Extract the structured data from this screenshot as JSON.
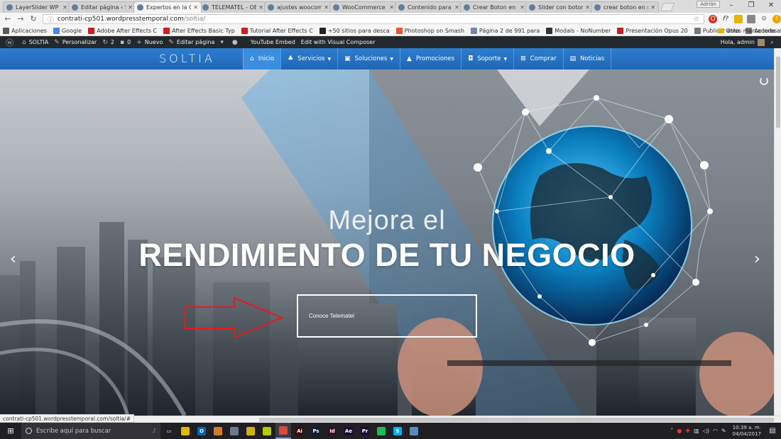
{
  "browser": {
    "tabs": [
      {
        "label": "LayerSlider WP - SOL",
        "active": false
      },
      {
        "label": "Editar página ‹ SOL",
        "active": false
      },
      {
        "label": "Expertos en la Cons",
        "active": true
      },
      {
        "label": "TELEMATEL - OBRA",
        "active": false
      },
      {
        "label": "ajustes woocomme",
        "active": false
      },
      {
        "label": "WooCommerce Me",
        "active": false
      },
      {
        "label": "Contenido para Wo",
        "active": false
      },
      {
        "label": "Crear Boton en slid",
        "active": false
      },
      {
        "label": "Slider con boton co",
        "active": false
      },
      {
        "label": "crear boton en slid",
        "active": false
      }
    ],
    "user_badge": "Adrián",
    "url_host": "contrati-cp501.wordpresstemporal.com",
    "url_path": "/soltia/",
    "bookmarks": [
      {
        "label": "Aplicaciones",
        "color": "#5a5a5a"
      },
      {
        "label": "Google",
        "color": "#4285f4"
      },
      {
        "label": "Adobe After Effects C",
        "color": "#cc1f1f"
      },
      {
        "label": "After Effects Basic Typ",
        "color": "#cc1f1f"
      },
      {
        "label": "Tutorial After Effects C",
        "color": "#cc1f1f"
      },
      {
        "label": "+50 sitios para desca",
        "color": "#222222"
      },
      {
        "label": "Photoshop on Smash",
        "color": "#e55a2b"
      },
      {
        "label": "Página 2 de 991 para",
        "color": "#6a8ab5"
      },
      {
        "label": "Modals - NoNumber",
        "color": "#333333"
      },
      {
        "label": "Presentación Opus 20",
        "color": "#cc1f1f"
      },
      {
        "label": "Publicar esto",
        "color": "#777777"
      },
      {
        "label": "Acceda al Webmail de",
        "color": "#777777"
      }
    ],
    "bookmarks_more": "»",
    "other_bookmarks": "Otros marcadores"
  },
  "wpbar": {
    "site": "SOLTIA",
    "customize": "Personalizar",
    "updates": "2",
    "comments": "0",
    "new": "Nuevo",
    "edit_page": "Editar página",
    "youtube_embed": "YouTube Embed",
    "visual_composer": "Edit with Visual Composer",
    "howdy": "Hola, admin"
  },
  "site": {
    "logo": "SOLTIA",
    "menu": [
      {
        "label": "Inicio",
        "icon": "⌂",
        "active": true,
        "caret": false
      },
      {
        "label": "Servicios",
        "icon": "♣",
        "active": false,
        "caret": true
      },
      {
        "label": "Soluciones",
        "icon": "▣",
        "active": false,
        "caret": true
      },
      {
        "label": "Promociones",
        "icon": "▲",
        "active": false,
        "caret": false
      },
      {
        "label": "Soporte",
        "icon": "◘",
        "active": false,
        "caret": true
      },
      {
        "label": "Comprar",
        "icon": "⊠",
        "active": false,
        "caret": false
      },
      {
        "label": "Noticias",
        "icon": "▤",
        "active": false,
        "caret": false
      }
    ]
  },
  "hero": {
    "headline_light": "Mejora el",
    "headline_bold": "RENDIMIENTO DE TU NEGOCIO",
    "cta_label": "Conoce Telematel",
    "prev": "‹",
    "next": "›"
  },
  "status_url": "contrati-cp501.wordpresstemporal.com/soltia/#",
  "taskbar": {
    "search_placeholder": "Escribe aquí para buscar",
    "apps": [
      {
        "name": "task-view",
        "color": "#1f1f24",
        "glyph": "▭"
      },
      {
        "name": "file-explorer",
        "color": "#e6b400",
        "glyph": ""
      },
      {
        "name": "outlook",
        "color": "#0a64b5",
        "glyph": "O"
      },
      {
        "name": "store",
        "color": "#d07c25",
        "glyph": ""
      },
      {
        "name": "network",
        "color": "#6a7a8a",
        "glyph": ""
      },
      {
        "name": "app-yellow-1",
        "color": "#d4b000",
        "glyph": ""
      },
      {
        "name": "app-yellow-2",
        "color": "#b8c800",
        "glyph": ""
      },
      {
        "name": "chrome",
        "color": "#d64b3c",
        "glyph": "",
        "active": true
      },
      {
        "name": "illustrator",
        "color": "#3a0a0a",
        "glyph": "Ai"
      },
      {
        "name": "photoshop",
        "color": "#0a1f33",
        "glyph": "Ps"
      },
      {
        "name": "indesign",
        "color": "#3a0a1f",
        "glyph": "Id"
      },
      {
        "name": "after-effects",
        "color": "#1a0a33",
        "glyph": "Ae"
      },
      {
        "name": "premiere",
        "color": "#1f0a33",
        "glyph": "Pr"
      },
      {
        "name": "spotify",
        "color": "#1db954",
        "glyph": ""
      },
      {
        "name": "skype",
        "color": "#00aff0",
        "glyph": "S"
      },
      {
        "name": "app-blue",
        "color": "#5a8ac0",
        "glyph": ""
      }
    ],
    "time": "10:39 a. m.",
    "date": "04/04/2017"
  }
}
